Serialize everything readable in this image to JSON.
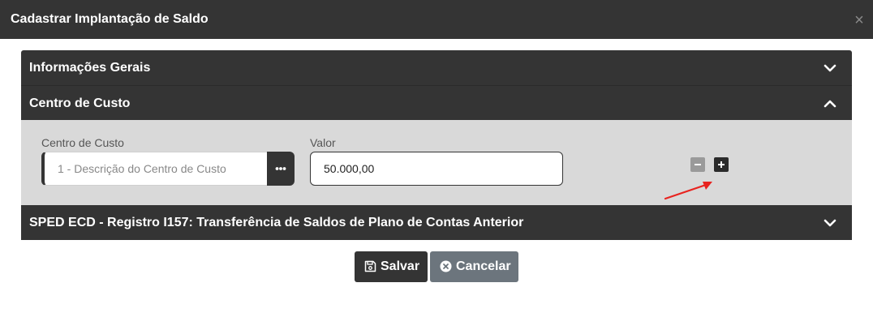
{
  "dialog": {
    "title": "Cadastrar Implantação de Saldo",
    "close_symbol": "×"
  },
  "sections": [
    {
      "title": "Informações Gerais",
      "expanded": false,
      "icon": "chevron-down-icon"
    },
    {
      "title": "Centro de Custo",
      "expanded": true,
      "icon": "chevron-up-icon"
    },
    {
      "title": "SPED ECD - Registro I157: Transferência de Saldos de Plano de Contas Anterior",
      "expanded": false,
      "icon": "chevron-down-icon"
    }
  ],
  "centro_de_custo": {
    "cc_label": "Centro de Custo",
    "cc_value": "1 - Descrição do Centro de Custo",
    "lookup_icon": "ellipsis-icon",
    "valor_label": "Valor",
    "valor_value": "50.000,00",
    "remove_icon": "minus-icon",
    "add_icon": "plus-icon",
    "annotation_color": "#e8231f"
  },
  "footer": {
    "save_label": "Salvar",
    "save_icon": "floppy-disk-icon",
    "cancel_label": "Cancelar",
    "cancel_icon": "times-circle-icon"
  },
  "colors": {
    "header_bg": "#343434",
    "panel_bg": "#d9d9d9",
    "cancel_bg": "#6c757d"
  }
}
